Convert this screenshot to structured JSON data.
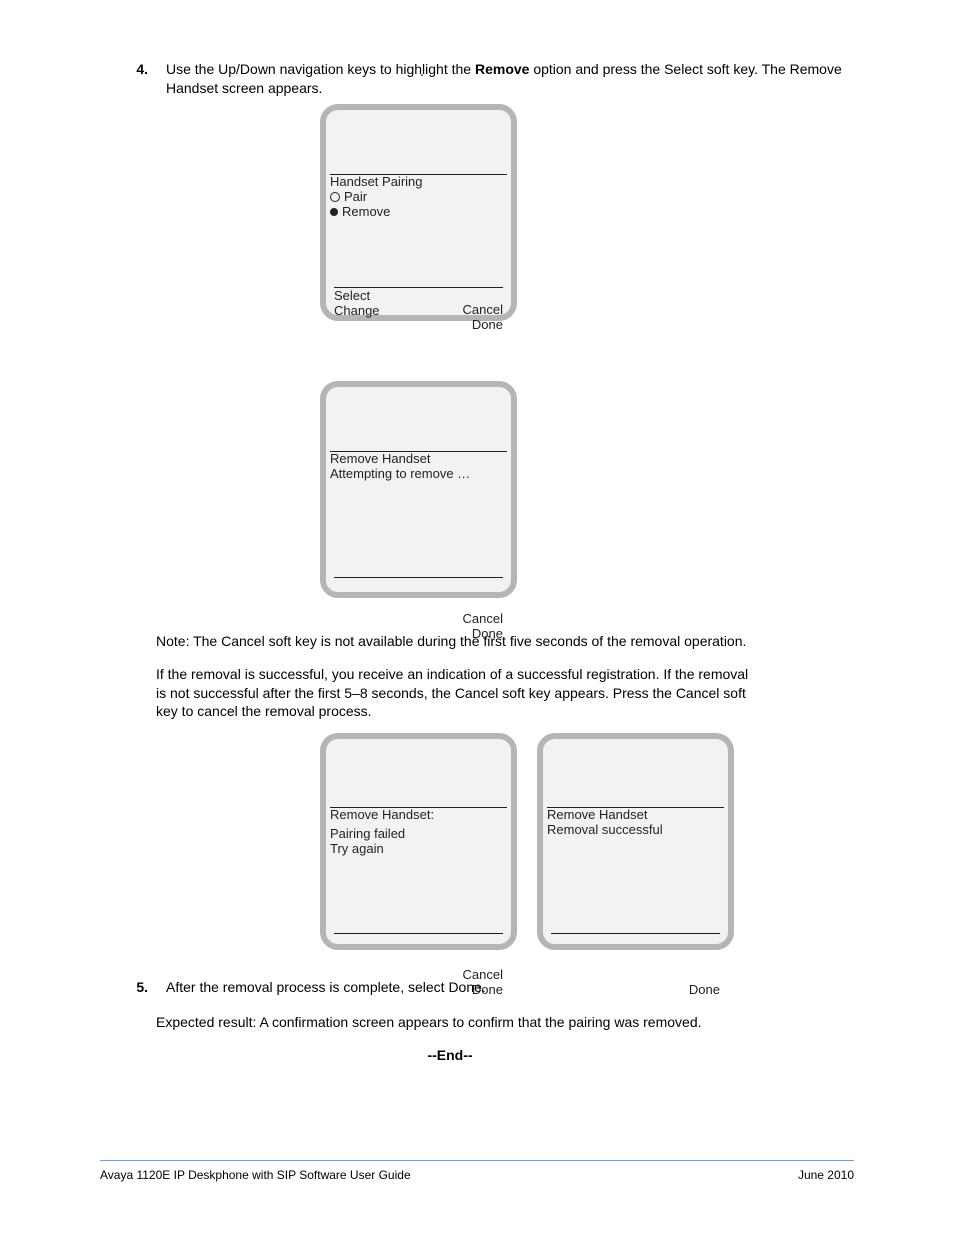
{
  "period": ".",
  "step4": {
    "num": "4.",
    "prefix": "Use the Up/Down navigation keys to highlight the ",
    "bold": "Remove",
    "suffix": " option and press the Select soft key. The Remove Handset screen appears."
  },
  "screen1": {
    "title": "Handset Pairing",
    "opt1": "Pair",
    "opt2": "Remove",
    "f_left1": "Select",
    "f_left2": "Change",
    "f_right1": "Cancel",
    "f_right2": "Done"
  },
  "screen2": {
    "title": "Remove Handset",
    "line": "Attempting to remove …",
    "f_right1": "Cancel",
    "f_right2": "Done"
  },
  "note": "Note: The Cancel soft key is not available during the first five seconds of the removal operation.",
  "after": "If the removal is successful,  you receive an indication of a successful registration. If the removal is not successful after the first 5–8 seconds, the Cancel soft key appears. Press the Cancel soft key to cancel the removal process.",
  "screen3": {
    "title": "Remove Handset:",
    "line1": "Pairing failed",
    "line2": "Try again",
    "f_right1": "Cancel",
    "f_right2": "Done"
  },
  "screen4": {
    "title": "Remove Handset",
    "line": "Removal successful",
    "f_right": "Done"
  },
  "step5": {
    "num": "5.",
    "text": "After the removal process is complete, select Done."
  },
  "expected": "Expected result: A confirmation screen appears to confirm that the pairing was removed.",
  "end": "--End--",
  "footer": {
    "left": "Avaya 1120E IP Deskphone with SIP Software User Guide",
    "right": "June 2010"
  }
}
